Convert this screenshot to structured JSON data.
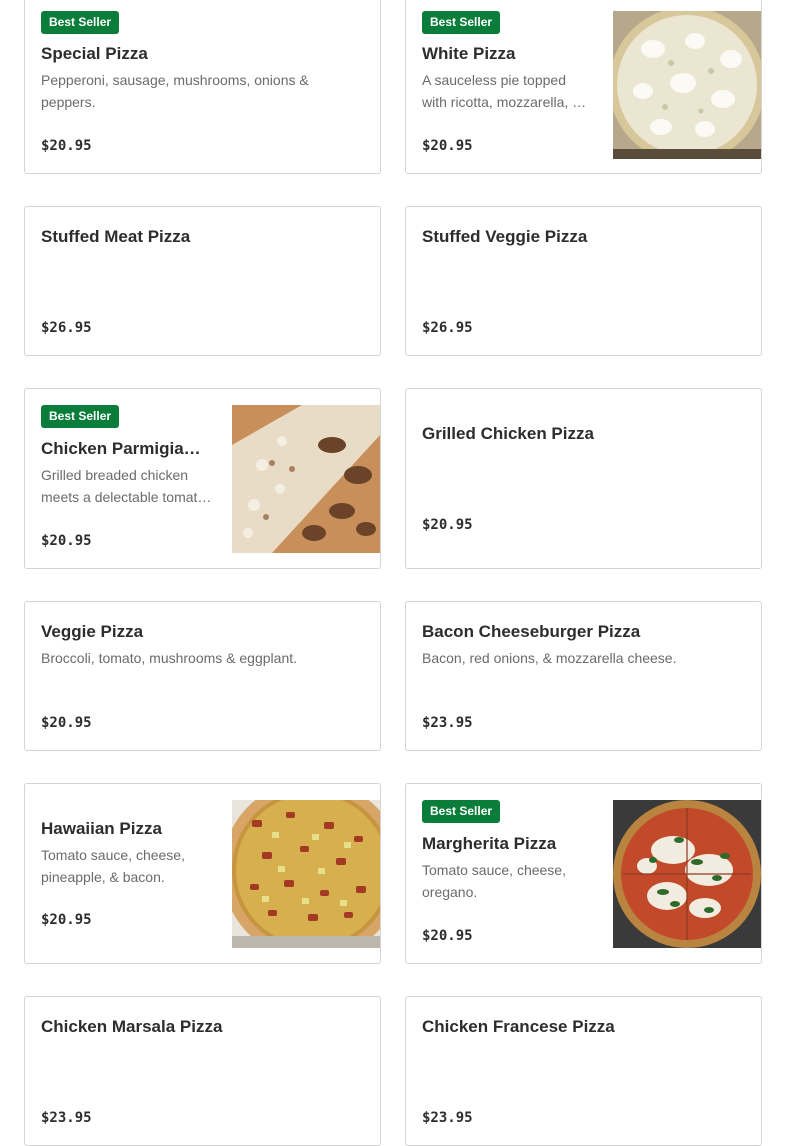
{
  "menu_items": [
    {
      "badge": "Best Seller",
      "name": "Special Pizza",
      "description": "Pepperoni, sausage, mushrooms, onions & peppers.",
      "price": "$20.95"
    },
    {
      "badge": "Best Seller",
      "name": "White Pizza",
      "description": "A sauceless pie topped with ricotta, mozzarella, …",
      "price": "$20.95",
      "image": "white-pizza-photo"
    },
    {
      "name": "Stuffed Meat Pizza",
      "price": "$26.95"
    },
    {
      "name": "Stuffed Veggie Pizza",
      "price": "$26.95"
    },
    {
      "badge": "Best Seller",
      "name": "Chicken Parmigiana…",
      "description": "Grilled breaded chicken meets a delectable tomat…",
      "price": "$20.95",
      "image": "chicken-parmigiana-pizza-photo"
    },
    {
      "name": "Grilled Chicken Pizza",
      "price": "$20.95"
    },
    {
      "name": "Veggie Pizza",
      "description": "Broccoli, tomato, mushrooms & eggplant.",
      "price": "$20.95"
    },
    {
      "name": "Bacon Cheeseburger Pizza",
      "description": "Bacon, red onions, & mozzarella cheese.",
      "price": "$23.95"
    },
    {
      "name": "Hawaiian Pizza",
      "description": "Tomato sauce, cheese, pineapple, & bacon.",
      "price": "$20.95",
      "image": "hawaiian-pizza-photo"
    },
    {
      "badge": "Best Seller",
      "name": "Margherita Pizza",
      "description": "Tomato sauce, cheese, oregano.",
      "price": "$20.95",
      "image": "margherita-pizza-photo"
    },
    {
      "name": "Chicken Marsala Pizza",
      "price": "$23.95"
    },
    {
      "name": "Chicken Francese Pizza",
      "price": "$23.95"
    }
  ]
}
